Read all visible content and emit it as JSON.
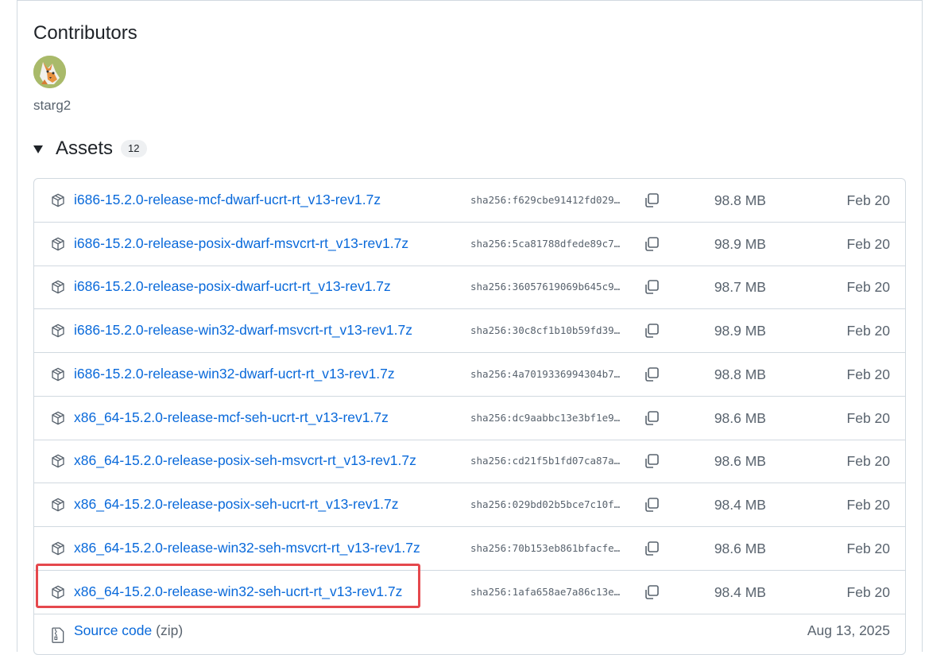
{
  "contributors": {
    "title": "Contributors",
    "users": [
      {
        "name": "starg2"
      }
    ]
  },
  "assets": {
    "title": "Assets",
    "count": "12",
    "items": [
      {
        "name": "i686-15.2.0-release-mcf-dwarf-ucrt-rt_v13-rev1.7z",
        "sha": "sha256:f629cbe91412fd029…",
        "size": "98.8 MB",
        "date": "Feb 20"
      },
      {
        "name": "i686-15.2.0-release-posix-dwarf-msvcrt-rt_v13-rev1.7z",
        "sha": "sha256:5ca81788dfede89c7…",
        "size": "98.9 MB",
        "date": "Feb 20"
      },
      {
        "name": "i686-15.2.0-release-posix-dwarf-ucrt-rt_v13-rev1.7z",
        "sha": "sha256:36057619069b645c9…",
        "size": "98.7 MB",
        "date": "Feb 20"
      },
      {
        "name": "i686-15.2.0-release-win32-dwarf-msvcrt-rt_v13-rev1.7z",
        "sha": "sha256:30c8cf1b10b59fd39…",
        "size": "98.9 MB",
        "date": "Feb 20"
      },
      {
        "name": "i686-15.2.0-release-win32-dwarf-ucrt-rt_v13-rev1.7z",
        "sha": "sha256:4a7019336994304b7…",
        "size": "98.8 MB",
        "date": "Feb 20"
      },
      {
        "name": "x86_64-15.2.0-release-mcf-seh-ucrt-rt_v13-rev1.7z",
        "sha": "sha256:dc9aabbc13e3bf1e9…",
        "size": "98.6 MB",
        "date": "Feb 20"
      },
      {
        "name": "x86_64-15.2.0-release-posix-seh-msvcrt-rt_v13-rev1.7z",
        "sha": "sha256:cd21f5b1fd07ca87a…",
        "size": "98.6 MB",
        "date": "Feb 20"
      },
      {
        "name": "x86_64-15.2.0-release-posix-seh-ucrt-rt_v13-rev1.7z",
        "sha": "sha256:029bd02b5bce7c10f…",
        "size": "98.4 MB",
        "date": "Feb 20"
      },
      {
        "name": "x86_64-15.2.0-release-win32-seh-msvcrt-rt_v13-rev1.7z",
        "sha": "sha256:70b153eb861bfacfe…",
        "size": "98.6 MB",
        "date": "Feb 20"
      },
      {
        "name": "x86_64-15.2.0-release-win32-seh-ucrt-rt_v13-rev1.7z",
        "sha": "sha256:1afa658ae7a86c13e…",
        "size": "98.4 MB",
        "date": "Feb 20"
      }
    ],
    "source_code": {
      "label": "Source code",
      "suffix": "(zip)",
      "date": "Aug 13, 2025"
    },
    "highlighted_index": 9
  },
  "colors": {
    "link": "#0969da",
    "muted": "#59636e",
    "border": "#d1d9e0",
    "highlight": "#e5484d"
  },
  "icons": {
    "asset": "package-icon",
    "copy": "copy-icon",
    "source": "file-zip-icon"
  }
}
